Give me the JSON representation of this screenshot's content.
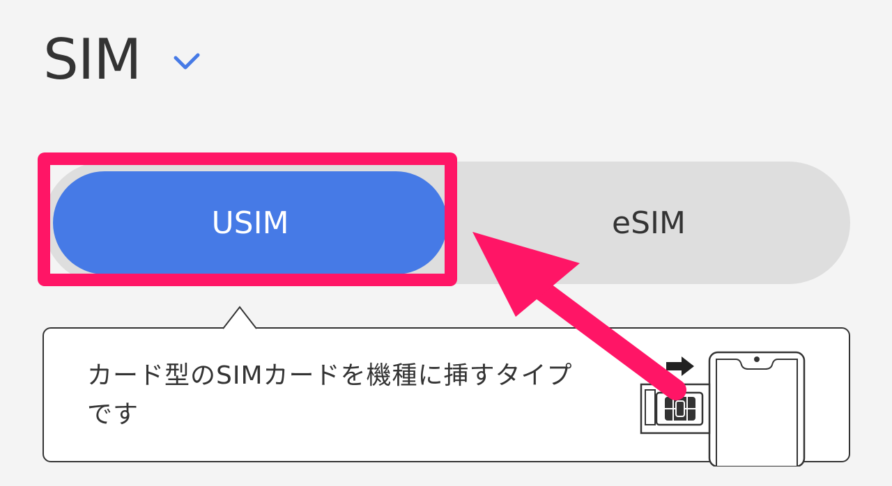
{
  "header": {
    "title": "SIM",
    "expand_icon": "chevron-down-icon"
  },
  "sim_type_toggle": {
    "options": [
      {
        "label": "USIM",
        "selected": true
      },
      {
        "label": "eSIM",
        "selected": false
      }
    ]
  },
  "description": {
    "text": "カード型のSIMカードを機種に挿すタイプです",
    "illustration_icon": "sim-card-insert-icon"
  },
  "colors": {
    "accent": "#467ae6",
    "annotation": "#ff1566",
    "toggle_track": "#dedede",
    "text": "#333333"
  }
}
